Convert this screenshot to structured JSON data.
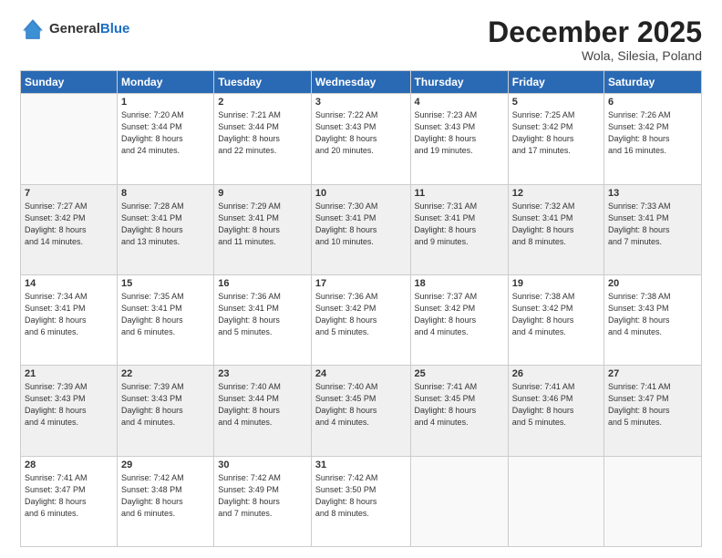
{
  "header": {
    "logo_general": "General",
    "logo_blue": "Blue",
    "month_title": "December 2025",
    "location": "Wola, Silesia, Poland"
  },
  "weekdays": [
    "Sunday",
    "Monday",
    "Tuesday",
    "Wednesday",
    "Thursday",
    "Friday",
    "Saturday"
  ],
  "weeks": [
    [
      {
        "day": "",
        "info": ""
      },
      {
        "day": "1",
        "info": "Sunrise: 7:20 AM\nSunset: 3:44 PM\nDaylight: 8 hours\nand 24 minutes."
      },
      {
        "day": "2",
        "info": "Sunrise: 7:21 AM\nSunset: 3:44 PM\nDaylight: 8 hours\nand 22 minutes."
      },
      {
        "day": "3",
        "info": "Sunrise: 7:22 AM\nSunset: 3:43 PM\nDaylight: 8 hours\nand 20 minutes."
      },
      {
        "day": "4",
        "info": "Sunrise: 7:23 AM\nSunset: 3:43 PM\nDaylight: 8 hours\nand 19 minutes."
      },
      {
        "day": "5",
        "info": "Sunrise: 7:25 AM\nSunset: 3:42 PM\nDaylight: 8 hours\nand 17 minutes."
      },
      {
        "day": "6",
        "info": "Sunrise: 7:26 AM\nSunset: 3:42 PM\nDaylight: 8 hours\nand 16 minutes."
      }
    ],
    [
      {
        "day": "7",
        "info": "Sunrise: 7:27 AM\nSunset: 3:42 PM\nDaylight: 8 hours\nand 14 minutes."
      },
      {
        "day": "8",
        "info": "Sunrise: 7:28 AM\nSunset: 3:41 PM\nDaylight: 8 hours\nand 13 minutes."
      },
      {
        "day": "9",
        "info": "Sunrise: 7:29 AM\nSunset: 3:41 PM\nDaylight: 8 hours\nand 11 minutes."
      },
      {
        "day": "10",
        "info": "Sunrise: 7:30 AM\nSunset: 3:41 PM\nDaylight: 8 hours\nand 10 minutes."
      },
      {
        "day": "11",
        "info": "Sunrise: 7:31 AM\nSunset: 3:41 PM\nDaylight: 8 hours\nand 9 minutes."
      },
      {
        "day": "12",
        "info": "Sunrise: 7:32 AM\nSunset: 3:41 PM\nDaylight: 8 hours\nand 8 minutes."
      },
      {
        "day": "13",
        "info": "Sunrise: 7:33 AM\nSunset: 3:41 PM\nDaylight: 8 hours\nand 7 minutes."
      }
    ],
    [
      {
        "day": "14",
        "info": "Sunrise: 7:34 AM\nSunset: 3:41 PM\nDaylight: 8 hours\nand 6 minutes."
      },
      {
        "day": "15",
        "info": "Sunrise: 7:35 AM\nSunset: 3:41 PM\nDaylight: 8 hours\nand 6 minutes."
      },
      {
        "day": "16",
        "info": "Sunrise: 7:36 AM\nSunset: 3:41 PM\nDaylight: 8 hours\nand 5 minutes."
      },
      {
        "day": "17",
        "info": "Sunrise: 7:36 AM\nSunset: 3:42 PM\nDaylight: 8 hours\nand 5 minutes."
      },
      {
        "day": "18",
        "info": "Sunrise: 7:37 AM\nSunset: 3:42 PM\nDaylight: 8 hours\nand 4 minutes."
      },
      {
        "day": "19",
        "info": "Sunrise: 7:38 AM\nSunset: 3:42 PM\nDaylight: 8 hours\nand 4 minutes."
      },
      {
        "day": "20",
        "info": "Sunrise: 7:38 AM\nSunset: 3:43 PM\nDaylight: 8 hours\nand 4 minutes."
      }
    ],
    [
      {
        "day": "21",
        "info": "Sunrise: 7:39 AM\nSunset: 3:43 PM\nDaylight: 8 hours\nand 4 minutes."
      },
      {
        "day": "22",
        "info": "Sunrise: 7:39 AM\nSunset: 3:43 PM\nDaylight: 8 hours\nand 4 minutes."
      },
      {
        "day": "23",
        "info": "Sunrise: 7:40 AM\nSunset: 3:44 PM\nDaylight: 8 hours\nand 4 minutes."
      },
      {
        "day": "24",
        "info": "Sunrise: 7:40 AM\nSunset: 3:45 PM\nDaylight: 8 hours\nand 4 minutes."
      },
      {
        "day": "25",
        "info": "Sunrise: 7:41 AM\nSunset: 3:45 PM\nDaylight: 8 hours\nand 4 minutes."
      },
      {
        "day": "26",
        "info": "Sunrise: 7:41 AM\nSunset: 3:46 PM\nDaylight: 8 hours\nand 5 minutes."
      },
      {
        "day": "27",
        "info": "Sunrise: 7:41 AM\nSunset: 3:47 PM\nDaylight: 8 hours\nand 5 minutes."
      }
    ],
    [
      {
        "day": "28",
        "info": "Sunrise: 7:41 AM\nSunset: 3:47 PM\nDaylight: 8 hours\nand 6 minutes."
      },
      {
        "day": "29",
        "info": "Sunrise: 7:42 AM\nSunset: 3:48 PM\nDaylight: 8 hours\nand 6 minutes."
      },
      {
        "day": "30",
        "info": "Sunrise: 7:42 AM\nSunset: 3:49 PM\nDaylight: 8 hours\nand 7 minutes."
      },
      {
        "day": "31",
        "info": "Sunrise: 7:42 AM\nSunset: 3:50 PM\nDaylight: 8 hours\nand 8 minutes."
      },
      {
        "day": "",
        "info": ""
      },
      {
        "day": "",
        "info": ""
      },
      {
        "day": "",
        "info": ""
      }
    ]
  ]
}
